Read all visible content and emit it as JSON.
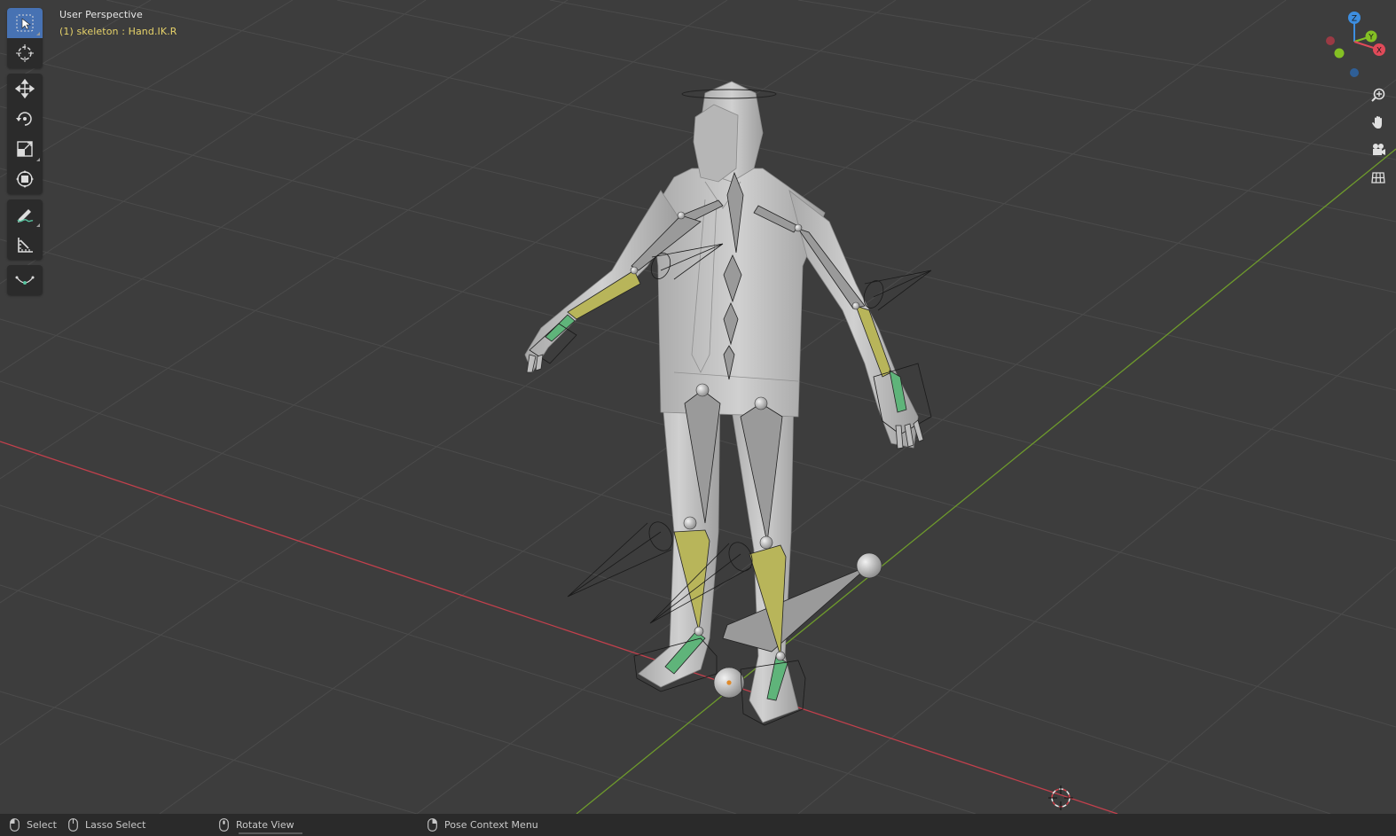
{
  "viewport": {
    "view_name": "User Perspective",
    "object_info": "(1) skeleton : Hand.IK.R"
  },
  "toolbar": {
    "tools": [
      {
        "name": "select-box-tool",
        "icon": "select-box-icon",
        "active": true
      },
      {
        "name": "cursor-tool",
        "icon": "cursor-icon"
      },
      {
        "name": "move-tool",
        "icon": "move-icon"
      },
      {
        "name": "rotate-tool",
        "icon": "rotate-icon"
      },
      {
        "name": "scale-tool",
        "icon": "scale-icon"
      },
      {
        "name": "transform-tool",
        "icon": "transform-icon"
      },
      {
        "name": "annotate-tool",
        "icon": "annotate-icon"
      },
      {
        "name": "measure-tool",
        "icon": "measure-icon"
      },
      {
        "name": "bone-curve-tool",
        "icon": "curve-icon"
      }
    ]
  },
  "navigation": {
    "axes": [
      "X",
      "Y",
      "Z"
    ],
    "axis_colors": {
      "x": "#e04a59",
      "y": "#84c024",
      "z": "#3d8ee0"
    },
    "buttons": [
      "zoom-icon",
      "pan-hand-icon",
      "camera-icon",
      "grid-icon"
    ]
  },
  "scene_colors": {
    "background": "#3d3d3d",
    "grid": "#4a4a4a",
    "x_axis": "#c2404c",
    "y_axis": "#6e9a2c",
    "bone_yellow": "#b8b55a",
    "bone_green": "#5fb47a"
  },
  "statusbar": {
    "select": "Select",
    "lasso_select": "Lasso Select",
    "rotate_view": "Rotate View",
    "pose_context_menu": "Pose Context Menu"
  }
}
